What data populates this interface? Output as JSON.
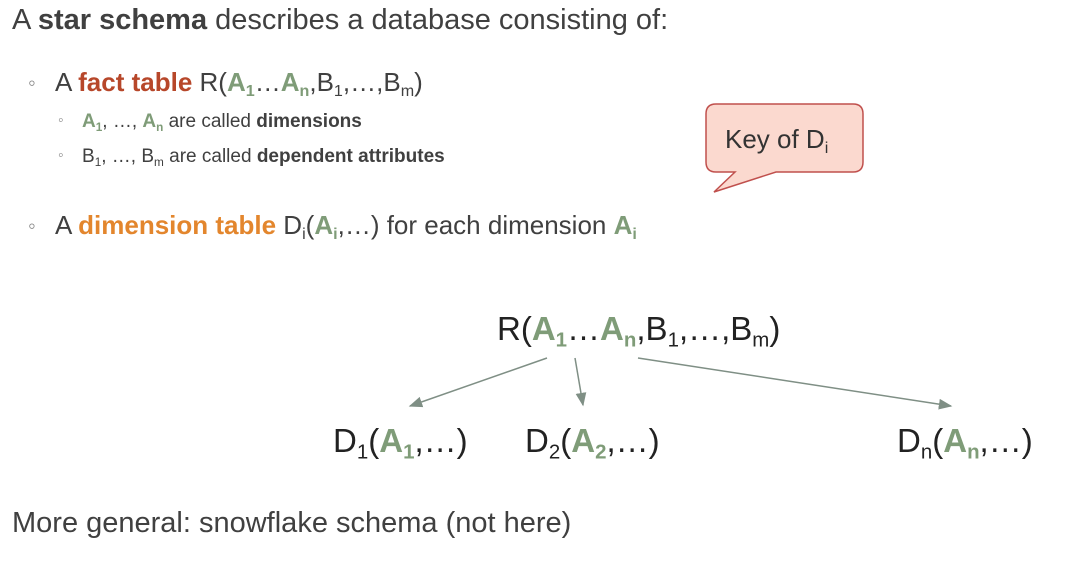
{
  "heading": {
    "pre": "A ",
    "strong": "star schema",
    "post": " describes a database consisting of:"
  },
  "bullet_char": "◦",
  "fact_bullet": {
    "pre": "A ",
    "strong": "fact table",
    "post": " "
  },
  "rel_R": "R(",
  "A": "A",
  "B": "B",
  "sub_1": "1",
  "sub_n": "n",
  "sub_m": "m",
  "sub_i": "i",
  "sub_2": "2",
  "ellipsis": "…",
  "comma": ",",
  "close": ")",
  "comma_ellipsis_comma": ", …, ",
  "dimensions_line": {
    "mid": " are called ",
    "strong": "dimensions"
  },
  "dependent_line": {
    "mid": " are called ",
    "strong": "dependent attributes"
  },
  "dim_bullet": {
    "pre": "A ",
    "strong": "dimension table",
    "d": " D",
    "open": "(",
    "rest": ",…) for each dimension "
  },
  "callout": {
    "text": "Key of D",
    "sub": "i"
  },
  "D": "D",
  "open": "(",
  "close_paren_ellipsis": ",…)",
  "footer": "More general: snowflake schema (not here)",
  "colors": {
    "green": "#7f9c78",
    "red": "#b7472a",
    "orange": "#e3862d",
    "callout_fill": "#fbd9cf",
    "callout_stroke": "#c0504d"
  }
}
